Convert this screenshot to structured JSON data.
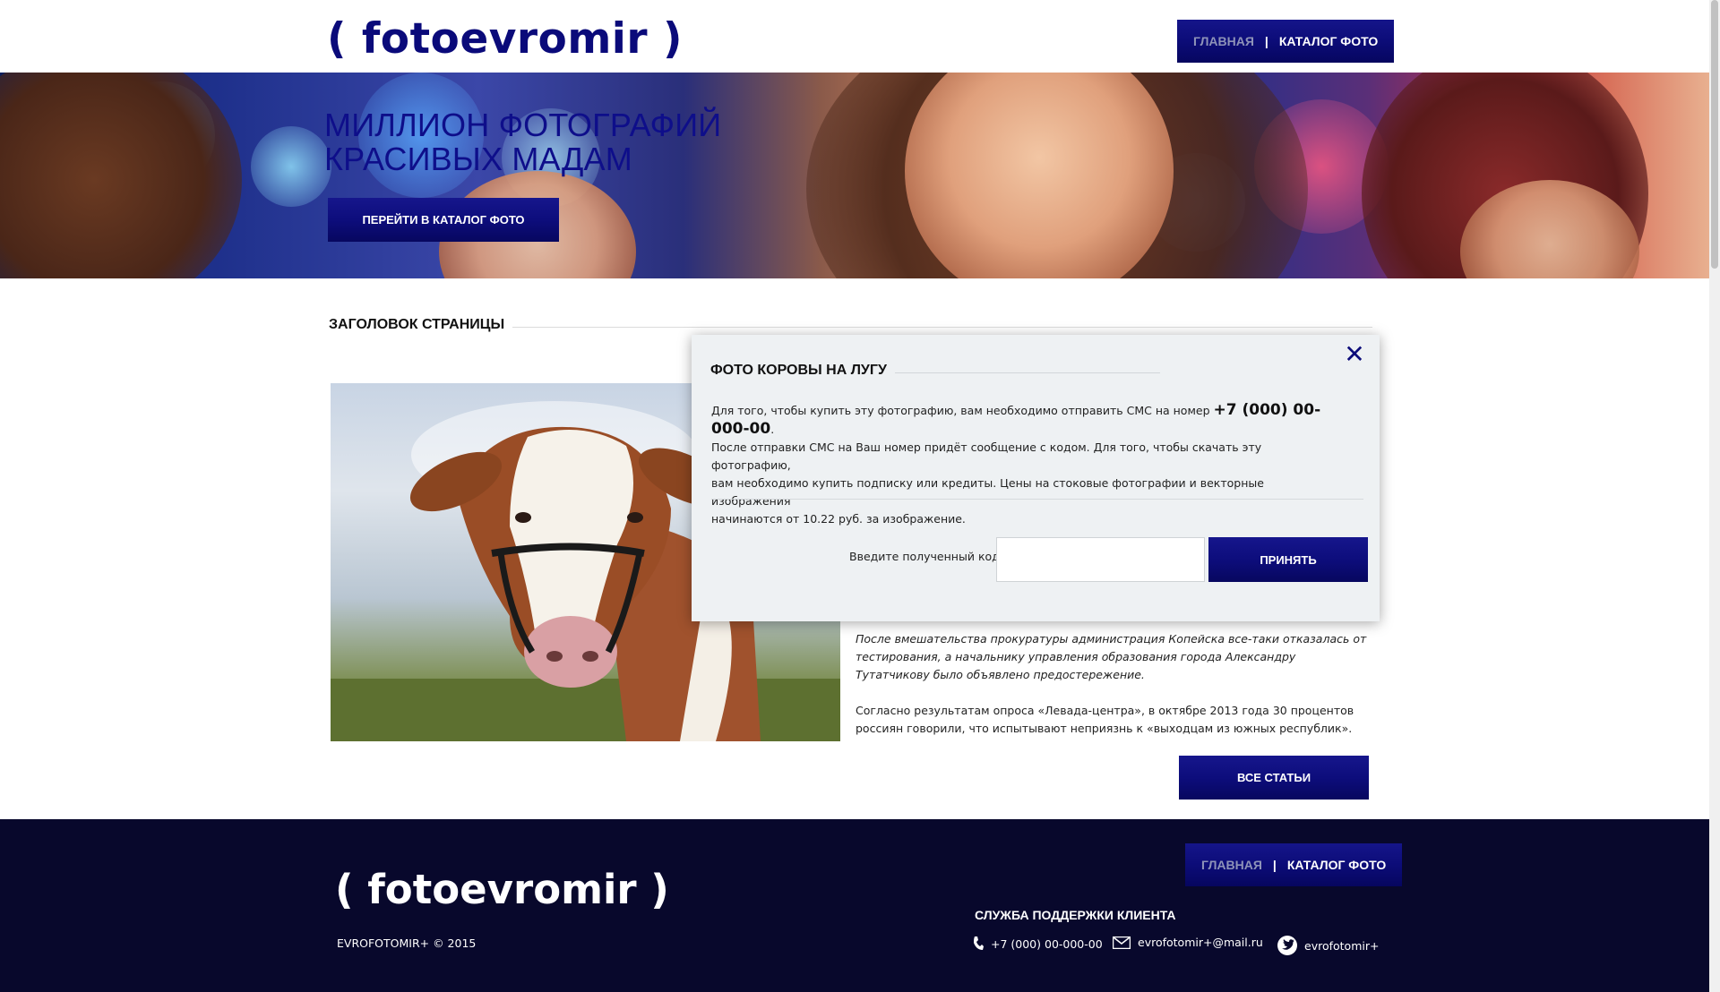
{
  "header": {
    "logo": "( fotoevromir )",
    "nav": {
      "home": "ГЛАВНАЯ",
      "separator": "|",
      "catalog": "КАТАЛОГ ФОТО"
    }
  },
  "banner": {
    "title_line1": "МИЛЛИОН ФОТОГРАФИЙ",
    "title_line2": "КРАСИВЫХ МАДАМ",
    "button": "ПЕРЕЙТИ В КАТАЛОГ ФОТО"
  },
  "main": {
    "page_title": "ЗАГОЛОВОК СТРАНИЦЫ",
    "article_paragraph_1": "После вмешательства прокуратуры администрация Копейска все-таки отказалась от тестирования, а начальнику управления образования города Александру Тутатчикову было объявлено предостережение.",
    "article_paragraph_2": "Согласно результатам опроса «Левада-центра», в октябре 2013 года 30 процентов россиян говорили, что испытывают неприязнь к «выходцам из южных республик».",
    "all_articles_button": "ВСЕ СТАТЬИ"
  },
  "modal": {
    "title": "ФОТО КОРОВЫ НА ЛУГУ",
    "text_before_phone": "Для того, чтобы купить эту фотографию, вам необходимо отправить СМС на номер ",
    "phone": "+7 (000) 00-000-00",
    "text_after_phone": ".",
    "text_line2": "После отправки СМС на Ваш номер придёт сообщение с кодом.  Для того, чтобы скачать эту фотографию,",
    "text_line3": "вам необходимо купить подписку или кредиты. Цены на стоковые фотографии и векторные изображения",
    "text_line4": "начинаются от 10.22 руб. за изображение.",
    "code_label": "Введите полученный код",
    "code_value": "",
    "accept_button": "ПРИНЯТЬ",
    "close_symbol": "✕"
  },
  "footer": {
    "logo": "( fotoevromir )",
    "copyright": "EVROFOTOMIR+ © 2015",
    "nav": {
      "home": "ГЛАВНАЯ",
      "separator": "|",
      "catalog": "КАТАЛОГ ФОТО"
    },
    "support_title": "СЛУЖБА ПОДДЕРЖКИ КЛИЕНТА",
    "phone": "+7 (000) 00-000-00",
    "email": "evrofotomir+@mail.ru",
    "twitter": "evrofotomir+"
  },
  "icons": {
    "close": "close-icon",
    "phone": "phone-icon",
    "email": "envelope-icon",
    "twitter": "twitter-icon"
  },
  "colors": {
    "brand_blue": "#0a0a7a",
    "button_blue": "#0d0d7c",
    "footer_bg": "#08082c",
    "modal_bg": "#eef1f3",
    "nav_active": "#8e93b8"
  }
}
